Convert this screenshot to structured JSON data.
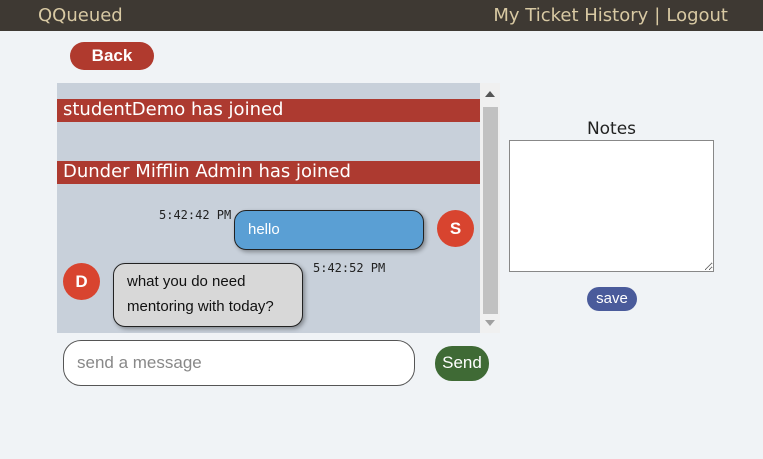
{
  "header": {
    "brand": "QQueued",
    "nav": {
      "history": "My Ticket History",
      "separator": "|",
      "logout": "Logout"
    }
  },
  "back_label": "Back",
  "chat": {
    "join_events": [
      {
        "text": "studentDemo has joined"
      },
      {
        "text": "Dunder Mifflin Admin has joined"
      }
    ],
    "messages": [
      {
        "from": "self",
        "time": "5:42:42 PM",
        "text": "hello",
        "avatar": "S"
      },
      {
        "from": "other",
        "time": "5:42:52 PM",
        "lines": [
          "what you do need",
          "mentoring with today?"
        ],
        "avatar": "D"
      }
    ]
  },
  "composer": {
    "placeholder": "send a message",
    "value": "",
    "send_label": "Send"
  },
  "notes": {
    "label": "Notes",
    "value": "",
    "save_label": "save"
  },
  "colors": {
    "topbar": "#3e3933",
    "brand_text": "#d8c9a3",
    "back": "#b03a2e",
    "join_banner": "#ad3a30",
    "self_bubble": "#5a9fd4",
    "other_bubble": "#d8d8d8",
    "avatar": "#d8442f",
    "send": "#3f6a35",
    "save": "#4a5b9b",
    "chat_bg": "#c8d0da"
  }
}
